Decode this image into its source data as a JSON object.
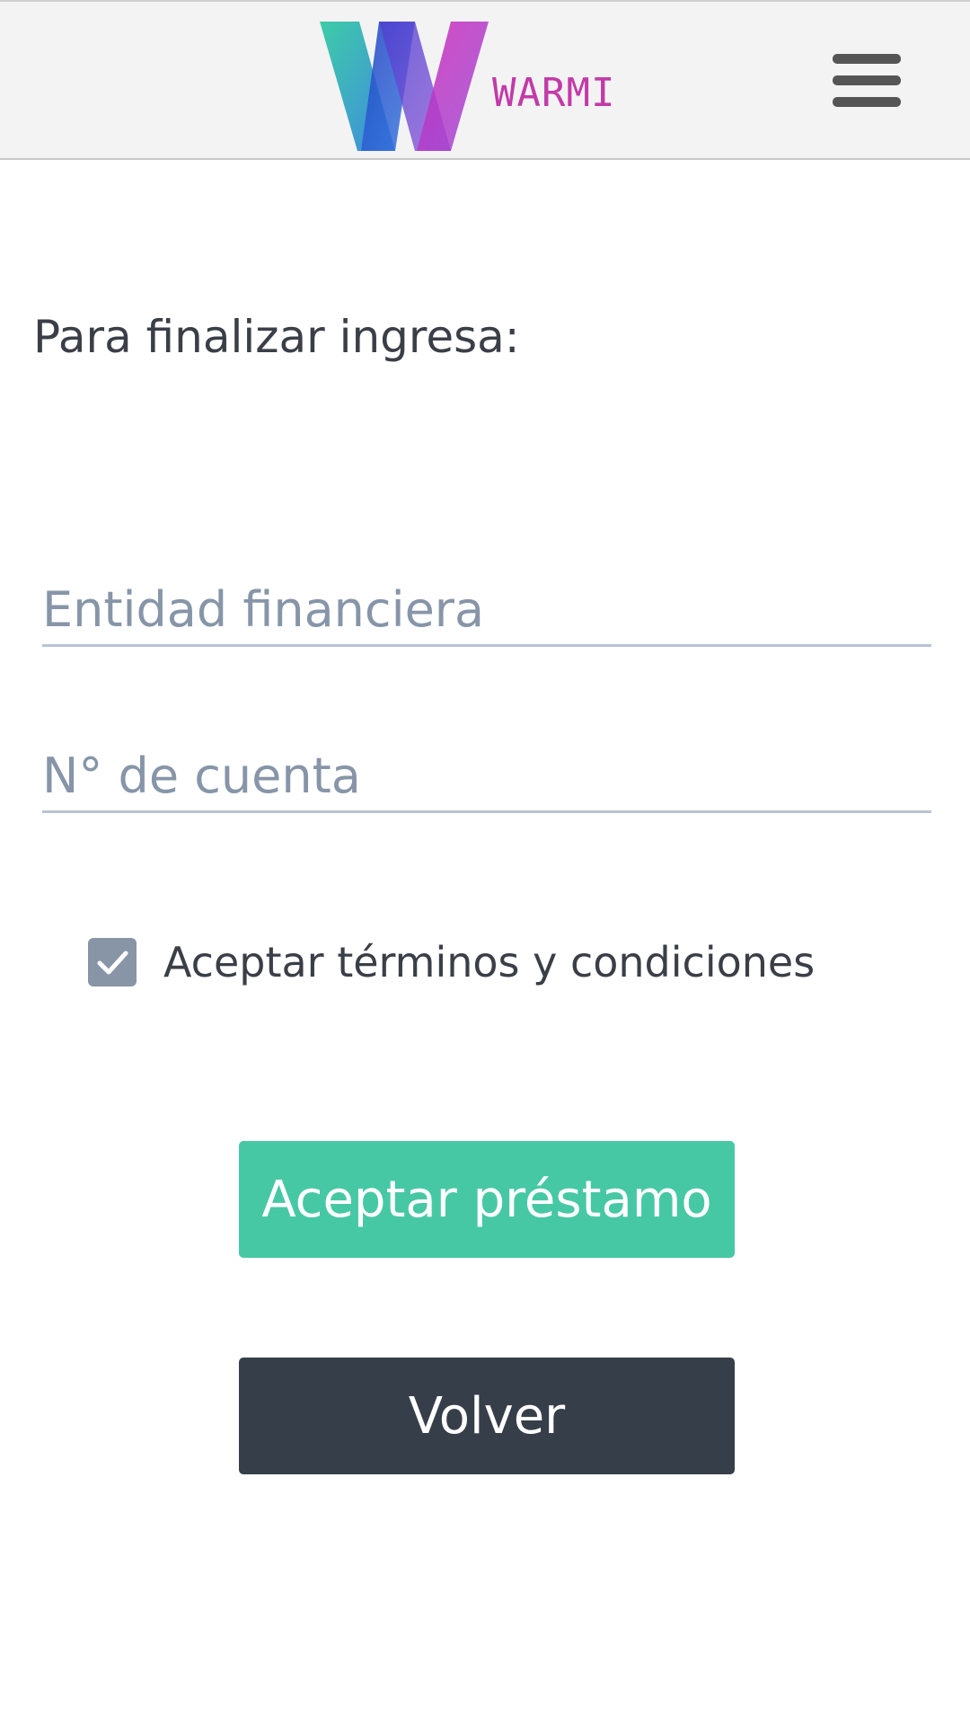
{
  "header": {
    "logo_text": "WARMI",
    "menu_icon": "hamburger-menu-icon"
  },
  "form": {
    "instruction": "Para finalizar ingresa:",
    "entity_placeholder": "Entidad financiera",
    "entity_value": "",
    "account_placeholder": "N° de cuenta",
    "account_value": "",
    "terms_label": "Aceptar términos y condiciones",
    "terms_checked": true
  },
  "actions": {
    "accept_label": "Aceptar préstamo",
    "back_label": "Volver"
  },
  "colors": {
    "accept_button": "#47c8a5",
    "back_button": "#363e49",
    "checkbox": "#8895a7",
    "logo_text": "#c23aa8"
  }
}
